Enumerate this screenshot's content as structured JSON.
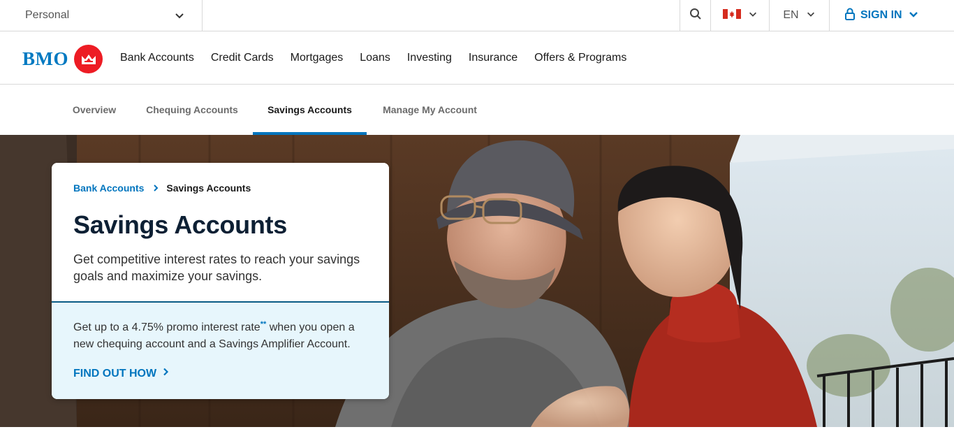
{
  "utility_bar": {
    "segment_label": "Personal",
    "language": "EN",
    "sign_in_label": "SIGN IN"
  },
  "brand": {
    "logo_text": "BMO",
    "primary_color": "#0075be",
    "roundel_color": "#ed1c24"
  },
  "main_nav": {
    "items": [
      {
        "label": "Bank Accounts"
      },
      {
        "label": "Credit Cards"
      },
      {
        "label": "Mortgages"
      },
      {
        "label": "Loans"
      },
      {
        "label": "Investing"
      },
      {
        "label": "Insurance"
      },
      {
        "label": "Offers & Programs"
      }
    ]
  },
  "sub_nav": {
    "items": [
      {
        "label": "Overview"
      },
      {
        "label": "Chequing Accounts"
      },
      {
        "label": "Savings Accounts"
      },
      {
        "label": "Manage My Account"
      }
    ],
    "active_index": 2
  },
  "hero": {
    "breadcrumb": {
      "parent": "Bank Accounts",
      "current": "Savings Accounts"
    },
    "title": "Savings Accounts",
    "description": "Get competitive interest rates to reach your savings goals and maximize your savings.",
    "promo": {
      "text_before": "Get up to a 4.75% promo interest rate",
      "footnote_marker": "**",
      "text_after": " when you open a new chequing account and a Savings Amplifier Account."
    },
    "cta_label": "FIND OUT HOW"
  }
}
